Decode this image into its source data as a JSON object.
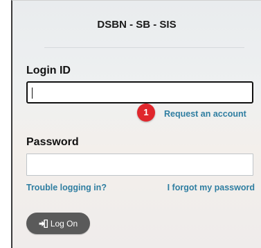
{
  "form": {
    "title": "DSBN - SB - SIS",
    "login_label": "Login ID",
    "login_value": "",
    "request_badge": "1",
    "request_link": "Request an account",
    "password_label": "Password",
    "password_value": "",
    "trouble_link": "Trouble logging in?",
    "forgot_link": "I forgot my password",
    "logon_label": "Log On",
    "logon_icon": "sign-in-icon"
  },
  "colors": {
    "link": "#2f7ea1",
    "badge": "#e0262c",
    "button": "#5a5a5a"
  }
}
